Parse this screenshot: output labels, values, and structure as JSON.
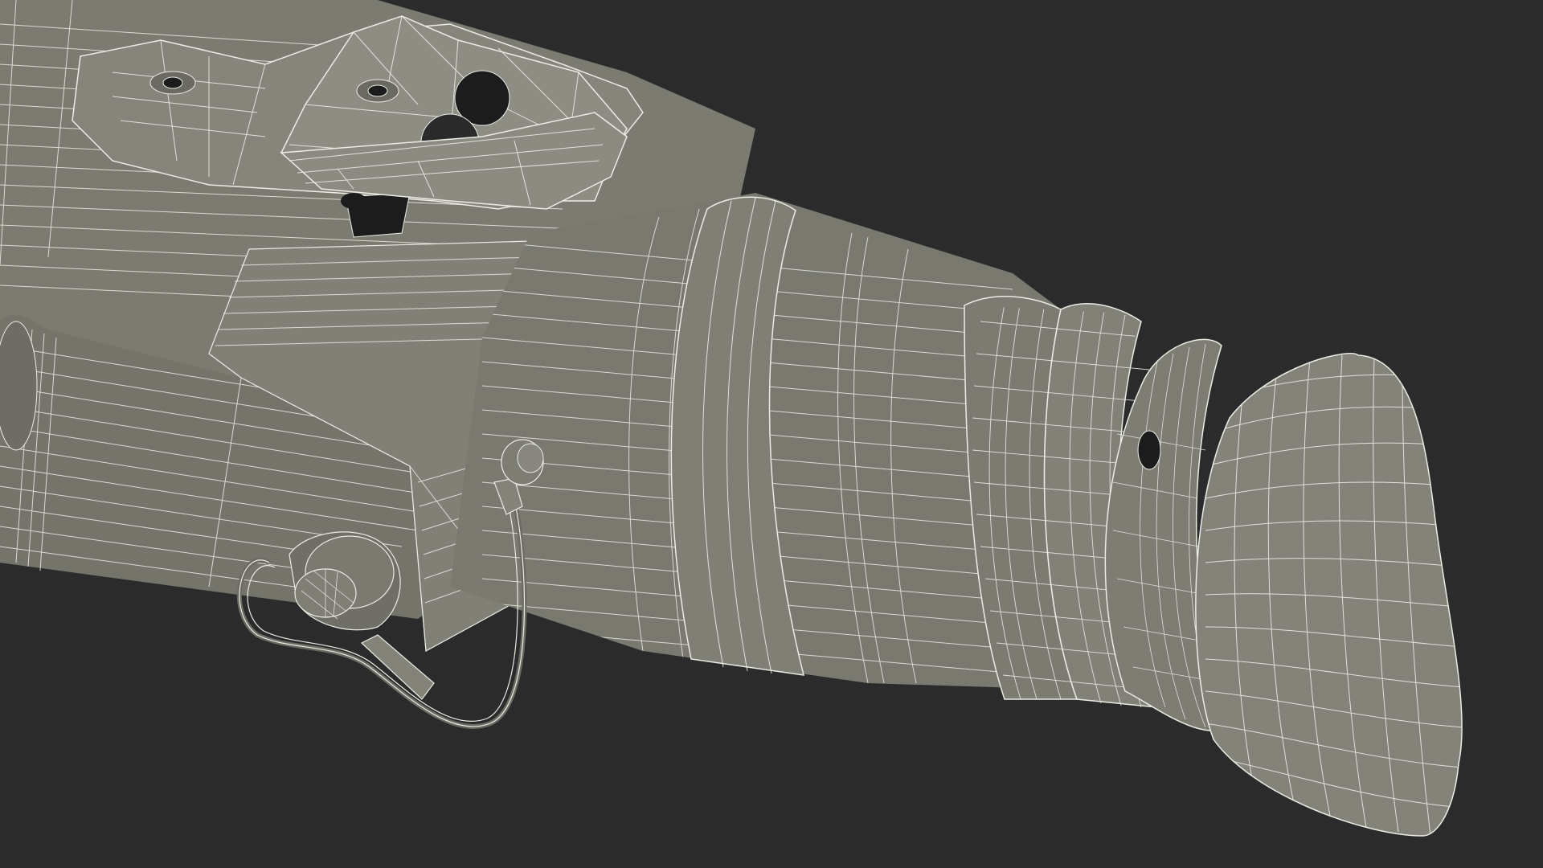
{
  "scene": {
    "background_color": "#2b2b2b",
    "surface_color": "#7b7b71",
    "surface_shadow_color": "#5f5f57",
    "surface_highlight_color": "#8c8c82",
    "wire_color": "#ecece4",
    "hole_color": "#1c1c1c"
  }
}
